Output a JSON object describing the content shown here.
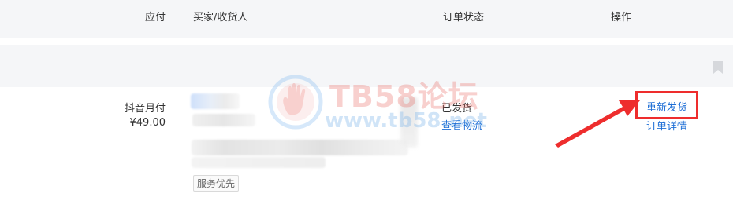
{
  "table_header": {
    "payable": "应付",
    "buyer_receiver": "买家/收货人",
    "order_status": "订单状态",
    "actions": "操作"
  },
  "order": {
    "payment_method": "抖音月付",
    "amount": "¥49.00",
    "service_tag": "服务优先",
    "status": "已发货",
    "view_logistics": "查看物流",
    "redeliver": "重新发货",
    "order_detail": "订单详情"
  },
  "watermark": {
    "title": "TB58论坛",
    "url": "www.tb58.net"
  },
  "colors": {
    "link": "#1f6fd6",
    "highlight": "#ee2d2d",
    "header_bg": "#f5f6f8"
  },
  "icons": {
    "bookmark": "bookmark-icon",
    "watermark_logo": "hand-logo-icon",
    "annotation_arrow": "red-arrow"
  }
}
